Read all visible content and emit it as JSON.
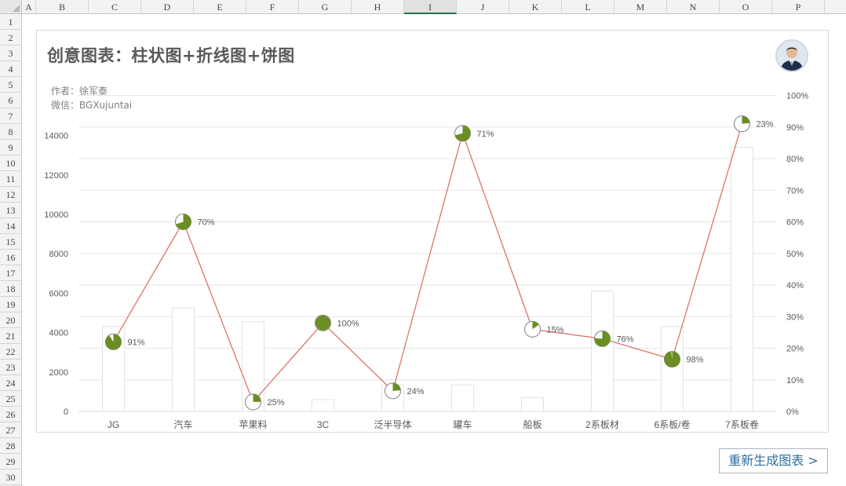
{
  "spreadsheet": {
    "columns": [
      "A",
      "B",
      "C",
      "D",
      "E",
      "F",
      "G",
      "H",
      "I",
      "J",
      "K",
      "L",
      "M",
      "N",
      "O",
      "P"
    ],
    "selected_column": "I",
    "rows": [
      "1",
      "2",
      "3",
      "4",
      "5",
      "6",
      "7",
      "8",
      "9",
      "10",
      "11",
      "12",
      "13",
      "14",
      "15",
      "16",
      "17",
      "18",
      "19",
      "20",
      "21",
      "22",
      "23",
      "24",
      "25",
      "26",
      "27",
      "28",
      "29",
      "30"
    ]
  },
  "chart": {
    "title": "创意图表：柱状图+折线图+饼图",
    "author_line": "作者：徐军泰",
    "wechat_line": "微信：BGXujuntai"
  },
  "regen_button": {
    "label": "重新生成图表 >"
  },
  "colors": {
    "line": "#d9746a",
    "pie_fill": "#6b8e23",
    "bar_border": "#e3e3e3",
    "grid": "#e6e6e6",
    "text": "#595959"
  },
  "chart_data": {
    "type": "bar",
    "categories": [
      "JG",
      "汽车",
      "苹果料",
      "3C",
      "泛半导体",
      "罐车",
      "船板",
      "2系板材",
      "6系板/卷",
      "7系板卷"
    ],
    "series": [
      {
        "type": "bar",
        "axis": "left",
        "values": [
          4300,
          5250,
          4550,
          600,
          1350,
          1350,
          700,
          6100,
          4300,
          13400
        ]
      },
      {
        "type": "line",
        "axis": "right",
        "values": [
          22,
          60,
          3,
          28,
          6.5,
          88,
          26,
          23,
          16.5,
          91
        ]
      },
      {
        "type": "pie",
        "values": [
          91,
          70,
          25,
          100,
          24,
          71,
          15,
          76,
          98,
          23
        ],
        "labels": [
          "91%",
          "70%",
          "25%",
          "100%",
          "24%",
          "71%",
          "15%",
          "76%",
          "98%",
          "23%"
        ]
      }
    ],
    "y_left": {
      "ylim": [
        0,
        16000
      ],
      "ticks": [
        "0",
        "2000",
        "4000",
        "6000",
        "8000",
        "10000",
        "12000",
        "14000"
      ]
    },
    "y_right": {
      "ylim": [
        0,
        100
      ],
      "ticks": [
        "0%",
        "10%",
        "20%",
        "30%",
        "40%",
        "50%",
        "60%",
        "70%",
        "80%",
        "90%",
        "100%"
      ]
    },
    "grid": true
  }
}
